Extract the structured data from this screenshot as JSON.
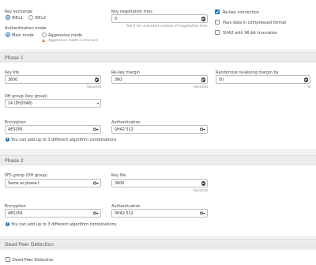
{
  "general": {
    "key_exchange_label": "Key exchange",
    "ikev1_label": "IKEv1",
    "ikev2_label": "IKEv2",
    "auth_mode_label": "Authentication mode",
    "main_mode_label": "Main mode",
    "aggressive_mode_label": "Aggressive mode",
    "aggressive_warning": "Aggressive mode is insecure",
    "negotiation_tries_label": "Key negotiation tries",
    "negotiation_tries_value": "0",
    "negotiation_tries_hint": "Set 0 for unlimited number of negotiation tries",
    "rekey_label": "Re-key connection",
    "pass_compressed_label": "Pass data in compressed format",
    "sha2_truncation_label": "SHA2 with 96-bit truncation"
  },
  "phase1": {
    "title": "Phase 1",
    "key_life_label": "Key life",
    "key_life_value": "3600",
    "key_life_unit": "Seconds",
    "rekey_margin_label": "Re-key margin",
    "rekey_margin_value": "360",
    "rekey_margin_unit": "Seconds",
    "randomize_label": "Randomize re-keying margin by",
    "randomize_value": "50",
    "randomize_unit": "%",
    "dh_group_label": "DH group (key group)",
    "dh_group_value": "14 (DH2048)",
    "encryption_label": "Encryption",
    "encryption_value": "AES256",
    "authentication_label": "Authentication",
    "authentication_value": "SHA2 512",
    "algo_note": "You can add up to 3 different algorithm combinations"
  },
  "phase2": {
    "title": "Phase 2",
    "pfs_label": "PFS group (DH group)",
    "pfs_value": "Same as phase-I",
    "key_life_label": "Key life",
    "key_life_value": "3600",
    "key_life_unit": "Seconds",
    "encryption_label": "Encryption",
    "encryption_value": "AES256",
    "authentication_label": "Authentication",
    "authentication_value": "SHA2 512",
    "algo_note": "You can add up to 3 different algorithm combinations"
  },
  "dpd": {
    "title": "Dead Peer Detection",
    "checkbox_label": "Dead Peer Detection"
  },
  "colors": {
    "accent": "#1a6fb5",
    "warning": "#d9822b",
    "section_header_bg": "#ececec"
  },
  "icons": {
    "ok": "check-circle-icon",
    "key": "key-icon",
    "dropdown": "chevron-down-icon",
    "info": "info-icon",
    "warning": "warning-icon"
  }
}
